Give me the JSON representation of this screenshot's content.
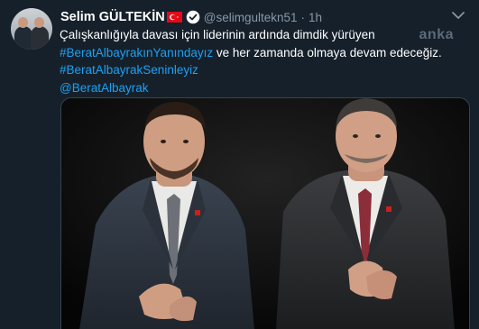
{
  "tweet": {
    "display_name": "Selim GÜLTEKİN",
    "handle": "@selimgultekn51",
    "separator": "·",
    "time": "1h",
    "watermark": "anka",
    "text_line1": "Çalışkanlığıyla davası için liderinin ardında dimdik yürüyen",
    "hashtag1": "#BeratAlbayrakınYanındayız",
    "text_line2_rest": " ve her zamanda olmaya devam edeceğiz.",
    "hashtag2": "#BeratAlbayrakSeninleyiz",
    "mention": "@BeratAlbayrak"
  },
  "colors": {
    "background": "#15202b",
    "text": "#ffffff",
    "secondary": "#8899a6",
    "link": "#1da1f2",
    "flag_red": "#e30a17"
  },
  "icons": {
    "flag": "turkey-flag-icon",
    "verified": "verified-badge-icon",
    "more": "chevron-down-icon"
  }
}
